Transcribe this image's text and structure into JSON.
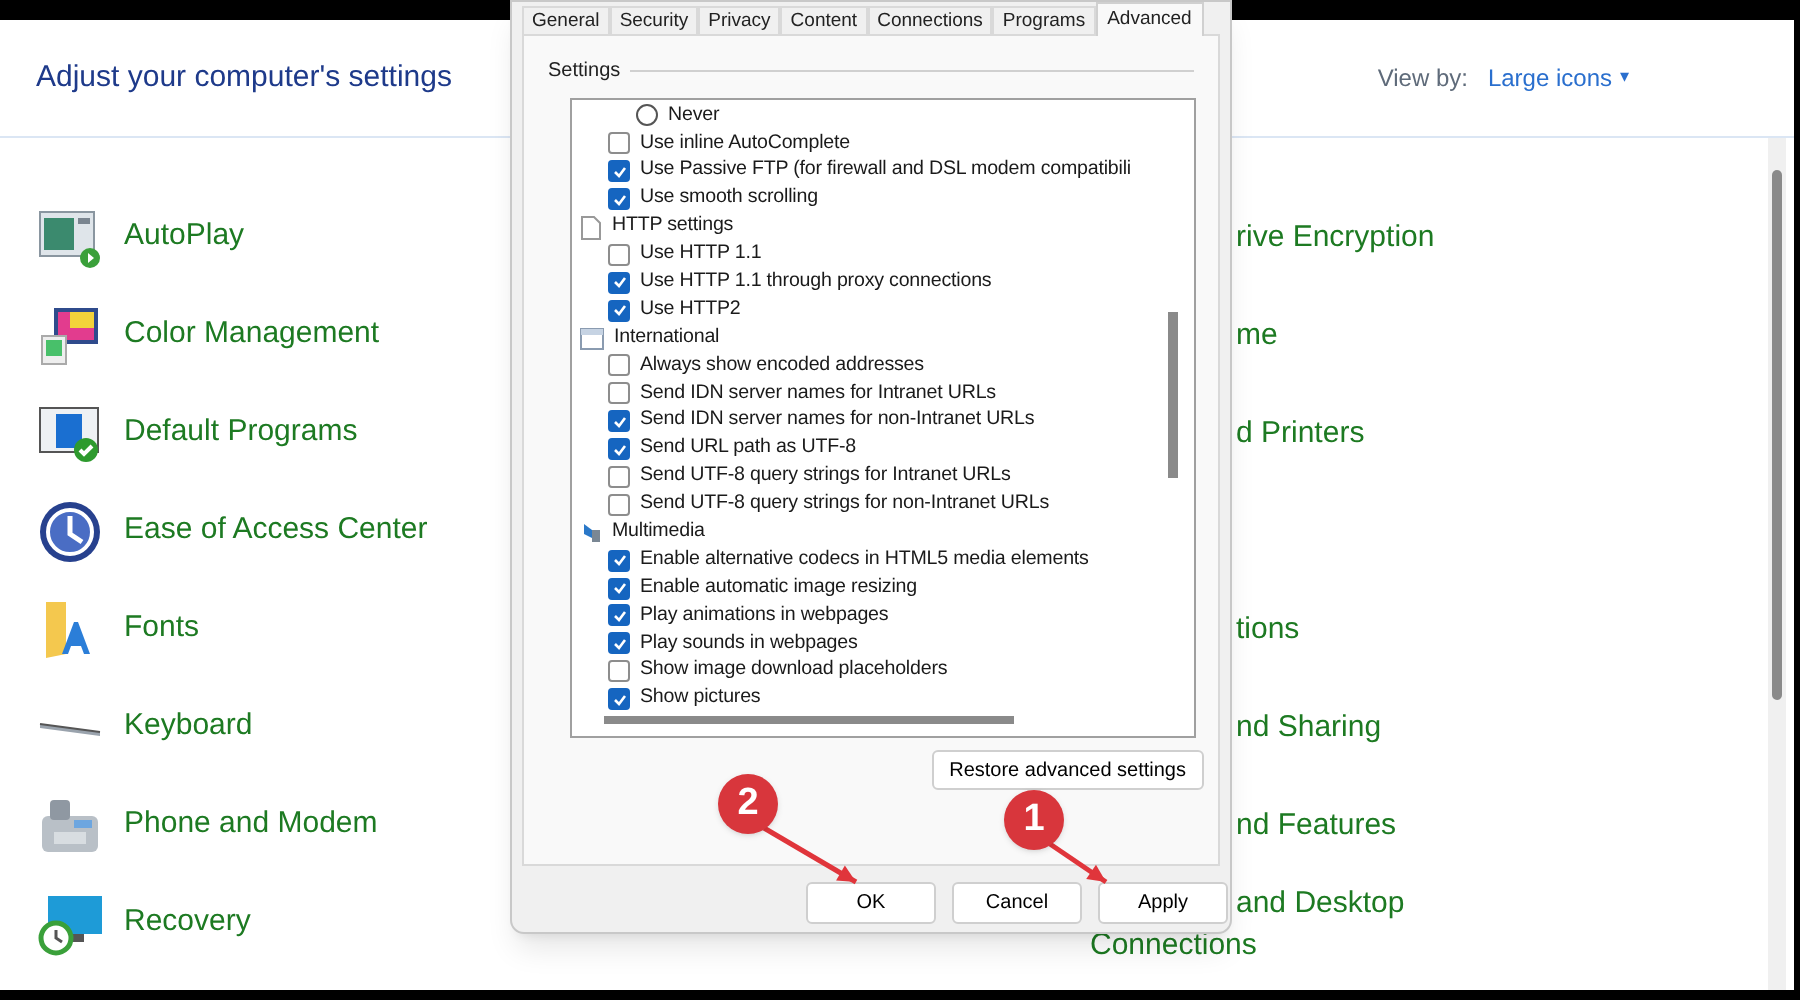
{
  "control_panel": {
    "title": "Adjust your computer's settings",
    "view_by": {
      "label": "View by:",
      "value": "Large icons",
      "caret": "▾"
    },
    "left_items": [
      {
        "label": "AutoPlay"
      },
      {
        "label": "Color Management"
      },
      {
        "label": "Default Programs"
      },
      {
        "label": "Ease of Access Center"
      },
      {
        "label": "Fonts"
      },
      {
        "label": "Keyboard"
      },
      {
        "label": "Phone and Modem"
      },
      {
        "label": "Recovery"
      }
    ],
    "right_items": [
      {
        "label": "rive Encryption"
      },
      {
        "label": "me"
      },
      {
        "label": "d Printers"
      },
      {
        "label": "tions"
      },
      {
        "label": "nd Sharing"
      },
      {
        "label": "nd Features"
      },
      {
        "label": "and Desktop",
        "continuation": "Connections"
      }
    ]
  },
  "dialog": {
    "tabs": [
      {
        "label": "General",
        "selected": false
      },
      {
        "label": "Security",
        "selected": false
      },
      {
        "label": "Privacy",
        "selected": false
      },
      {
        "label": "Content",
        "selected": false
      },
      {
        "label": "Connections",
        "selected": false
      },
      {
        "label": "Programs",
        "selected": false
      },
      {
        "label": "Advanced",
        "selected": true
      }
    ],
    "group_label": "Settings",
    "settings": [
      {
        "kind": "radio",
        "label": "Never",
        "checked": false
      },
      {
        "kind": "checkbox",
        "label": "Use inline AutoComplete",
        "checked": false
      },
      {
        "kind": "checkbox",
        "label": "Use Passive FTP (for firewall and DSL modem compatibili",
        "checked": true
      },
      {
        "kind": "checkbox",
        "label": "Use smooth scrolling",
        "checked": true
      },
      {
        "kind": "group",
        "label": "HTTP settings"
      },
      {
        "kind": "checkbox",
        "label": "Use HTTP 1.1",
        "checked": false
      },
      {
        "kind": "checkbox",
        "label": "Use HTTP 1.1 through proxy connections",
        "checked": true
      },
      {
        "kind": "checkbox",
        "label": "Use HTTP2",
        "checked": true
      },
      {
        "kind": "group",
        "label": "International"
      },
      {
        "kind": "checkbox",
        "label": "Always show encoded addresses",
        "checked": false
      },
      {
        "kind": "checkbox",
        "label": "Send IDN server names for Intranet URLs",
        "checked": false
      },
      {
        "kind": "checkbox",
        "label": "Send IDN server names for non-Intranet URLs",
        "checked": true
      },
      {
        "kind": "checkbox",
        "label": "Send URL path as UTF-8",
        "checked": true
      },
      {
        "kind": "checkbox",
        "label": "Send UTF-8 query strings for Intranet URLs",
        "checked": false
      },
      {
        "kind": "checkbox",
        "label": "Send UTF-8 query strings for non-Intranet URLs",
        "checked": false
      },
      {
        "kind": "group",
        "label": "Multimedia"
      },
      {
        "kind": "checkbox",
        "label": "Enable alternative codecs in HTML5 media elements",
        "checked": true
      },
      {
        "kind": "checkbox",
        "label": "Enable automatic image resizing",
        "checked": true
      },
      {
        "kind": "checkbox",
        "label": "Play animations in webpages",
        "checked": true
      },
      {
        "kind": "checkbox",
        "label": "Play sounds in webpages",
        "checked": true
      },
      {
        "kind": "checkbox",
        "label": "Show image download placeholders",
        "checked": false
      },
      {
        "kind": "checkbox",
        "label": "Show pictures",
        "checked": true
      }
    ],
    "restore_button": "Restore advanced settings",
    "buttons": [
      "OK",
      "Cancel",
      "Apply"
    ]
  },
  "annotations": [
    {
      "number": "2"
    },
    {
      "number": "1"
    }
  ]
}
